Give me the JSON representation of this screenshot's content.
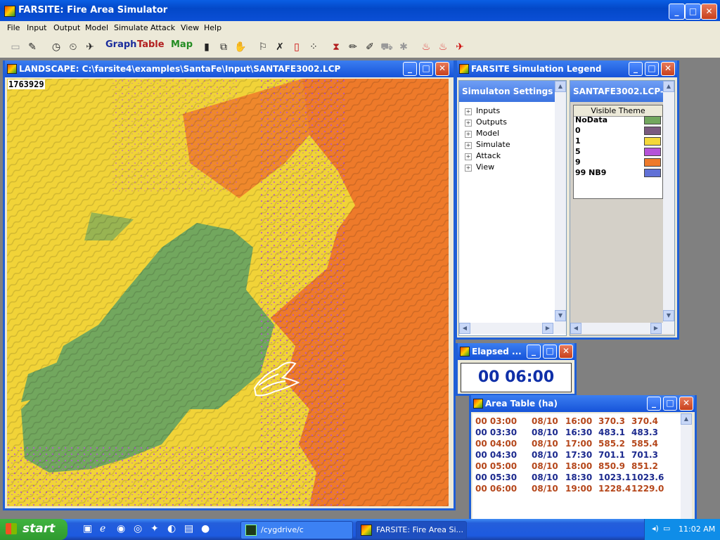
{
  "app": {
    "title": "FARSITE: Fire Area Simulator"
  },
  "menu": [
    "File",
    "Input",
    "Output",
    "Model",
    "Simulate",
    "Attack",
    "View",
    "Help"
  ],
  "toolbar": {
    "graph_label": "Graph",
    "table_label": "Table",
    "map_label": "Map"
  },
  "landscape": {
    "title": "LANDSCAPE: C:\\farsite4\\examples\\SantaFe\\Input\\SANTAFE3002.LCP",
    "coord_readout": "1763929"
  },
  "legend_window": {
    "title": "FARSITE Simulation Legend",
    "settings_header": "Simulaton Settings",
    "settings_items": [
      "Inputs",
      "Outputs",
      "Model",
      "Simulate",
      "Attack",
      "View"
    ],
    "theme_header": "SANTAFE3002.LCP-",
    "theme_column": "Visible Theme",
    "theme_rows": [
      {
        "label": "NoData",
        "color": "#72a75e"
      },
      {
        "label": "0",
        "color": "#7a5a7f"
      },
      {
        "label": "1",
        "color": "#f4d83a"
      },
      {
        "label": "5",
        "color": "#b553d8"
      },
      {
        "label": "9",
        "color": "#ee7a2a"
      },
      {
        "label": "99 NB9",
        "color": "#6171d6"
      }
    ]
  },
  "elapsed": {
    "title": "Elapsed ...",
    "value": "00 06:00"
  },
  "area_table": {
    "title": "Area Table (ha)",
    "rows": [
      {
        "elapsed": "00 03:00",
        "date": "08/10",
        "time": "16:00",
        "a": "370.3",
        "b": "370.4",
        "color": "#b5471b"
      },
      {
        "elapsed": "00 03:30",
        "date": "08/10",
        "time": "16:30",
        "a": "483.1",
        "b": "483.3",
        "color": "#1c2a8e"
      },
      {
        "elapsed": "00 04:00",
        "date": "08/10",
        "time": "17:00",
        "a": "585.2",
        "b": "585.4",
        "color": "#b5471b"
      },
      {
        "elapsed": "00 04:30",
        "date": "08/10",
        "time": "17:30",
        "a": "701.1",
        "b": "701.3",
        "color": "#1c2a8e"
      },
      {
        "elapsed": "00 05:00",
        "date": "08/10",
        "time": "18:00",
        "a": "850.9",
        "b": "851.2",
        "color": "#b5471b"
      },
      {
        "elapsed": "00 05:30",
        "date": "08/10",
        "time": "18:30",
        "a": "1023.1",
        "b": "1023.6",
        "color": "#1c2a8e"
      },
      {
        "elapsed": "00 06:00",
        "date": "08/10",
        "time": "19:00",
        "a": "1228.4",
        "b": "1229.0",
        "color": "#b5471b"
      }
    ]
  },
  "taskbar": {
    "start_label": "start",
    "tasks": [
      "/cygdrive/c",
      "FARSITE: Fire Area Si..."
    ],
    "clock": "11:02 AM"
  }
}
